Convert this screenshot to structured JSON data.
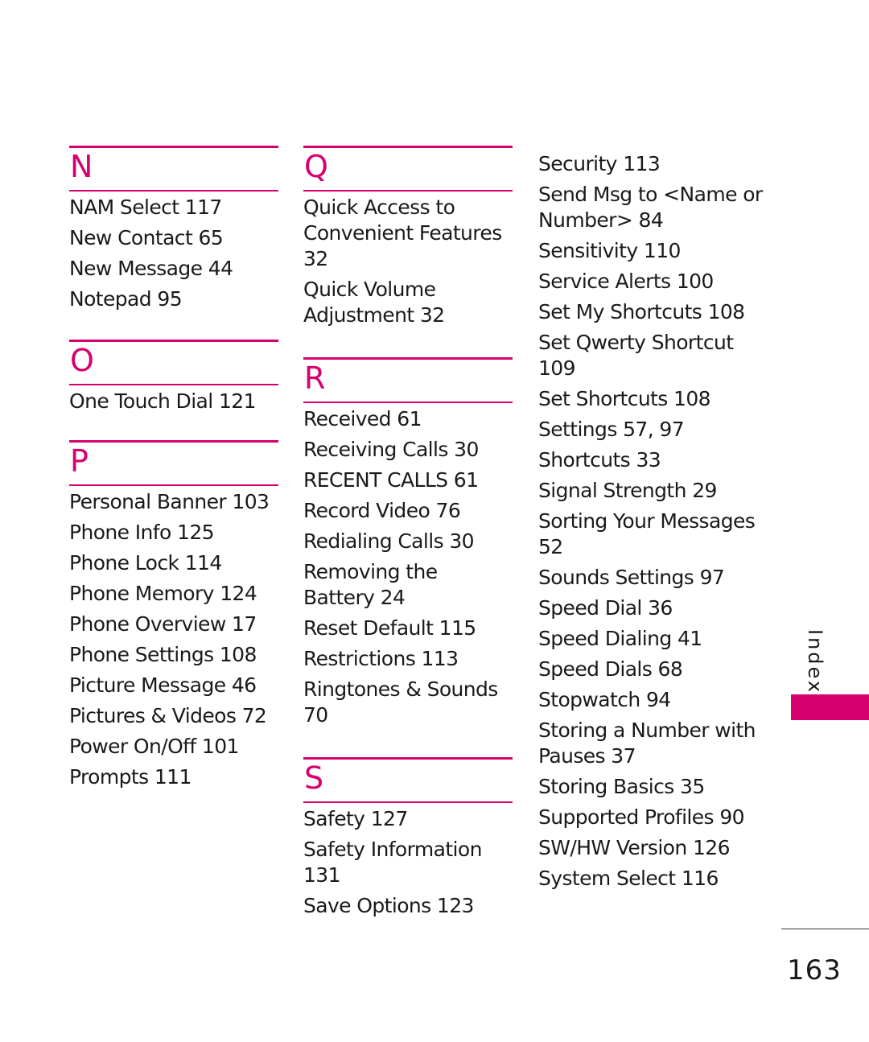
{
  "accent_color": "#d6006f",
  "sections": [
    {
      "letter": "N",
      "entries": [
        "NAM Select 117",
        "New Contact 65",
        "New Message 44",
        "Notepad 95"
      ]
    },
    {
      "letter": "O",
      "entries": [
        "One Touch Dial 121"
      ]
    },
    {
      "letter": "P",
      "entries": [
        "Personal Banner 103",
        "Phone Info 125",
        "Phone Lock 114",
        "Phone Memory 124",
        "Phone Overview 17",
        "Phone Settings 108",
        "Picture Message 46",
        "Pictures & Videos 72",
        "Power On/Off 101",
        "Prompts 111"
      ]
    },
    {
      "letter": "Q",
      "entries": [
        "Quick Access to Convenient Features 32",
        "Quick Volume Adjustment 32"
      ]
    },
    {
      "letter": "R",
      "entries": [
        "Received 61",
        "Receiving Calls 30",
        "RECENT CALLS 61",
        "Record Video 76",
        "Redialing Calls 30",
        "Removing the Battery 24",
        "Reset Default 115",
        "Restrictions 113",
        "Ringtones & Sounds 70"
      ]
    },
    {
      "letter": "S",
      "entries": [
        "Safety 127",
        "Safety Information 131",
        "Save Options 123",
        "Security 113",
        "Send Msg to <Name or Number> 84",
        "Sensitivity 110",
        "Service Alerts 100",
        "Set My Shortcuts 108",
        "Set Qwerty Shortcut 109",
        "Set Shortcuts 108",
        "Settings 57, 97",
        "Shortcuts 33",
        "Signal Strength 29",
        "Sorting Your Messages 52",
        "Sounds Settings 97",
        "Speed Dial 36",
        "Speed Dialing 41",
        "Speed Dials 68",
        "Stopwatch 94",
        "Storing a Number with Pauses 37",
        "Storing Basics 35",
        "Supported Profiles 90",
        "SW/HW Version 126",
        "System Select 116"
      ]
    }
  ],
  "side_tab": {
    "label": "Index"
  },
  "page_number": "163"
}
